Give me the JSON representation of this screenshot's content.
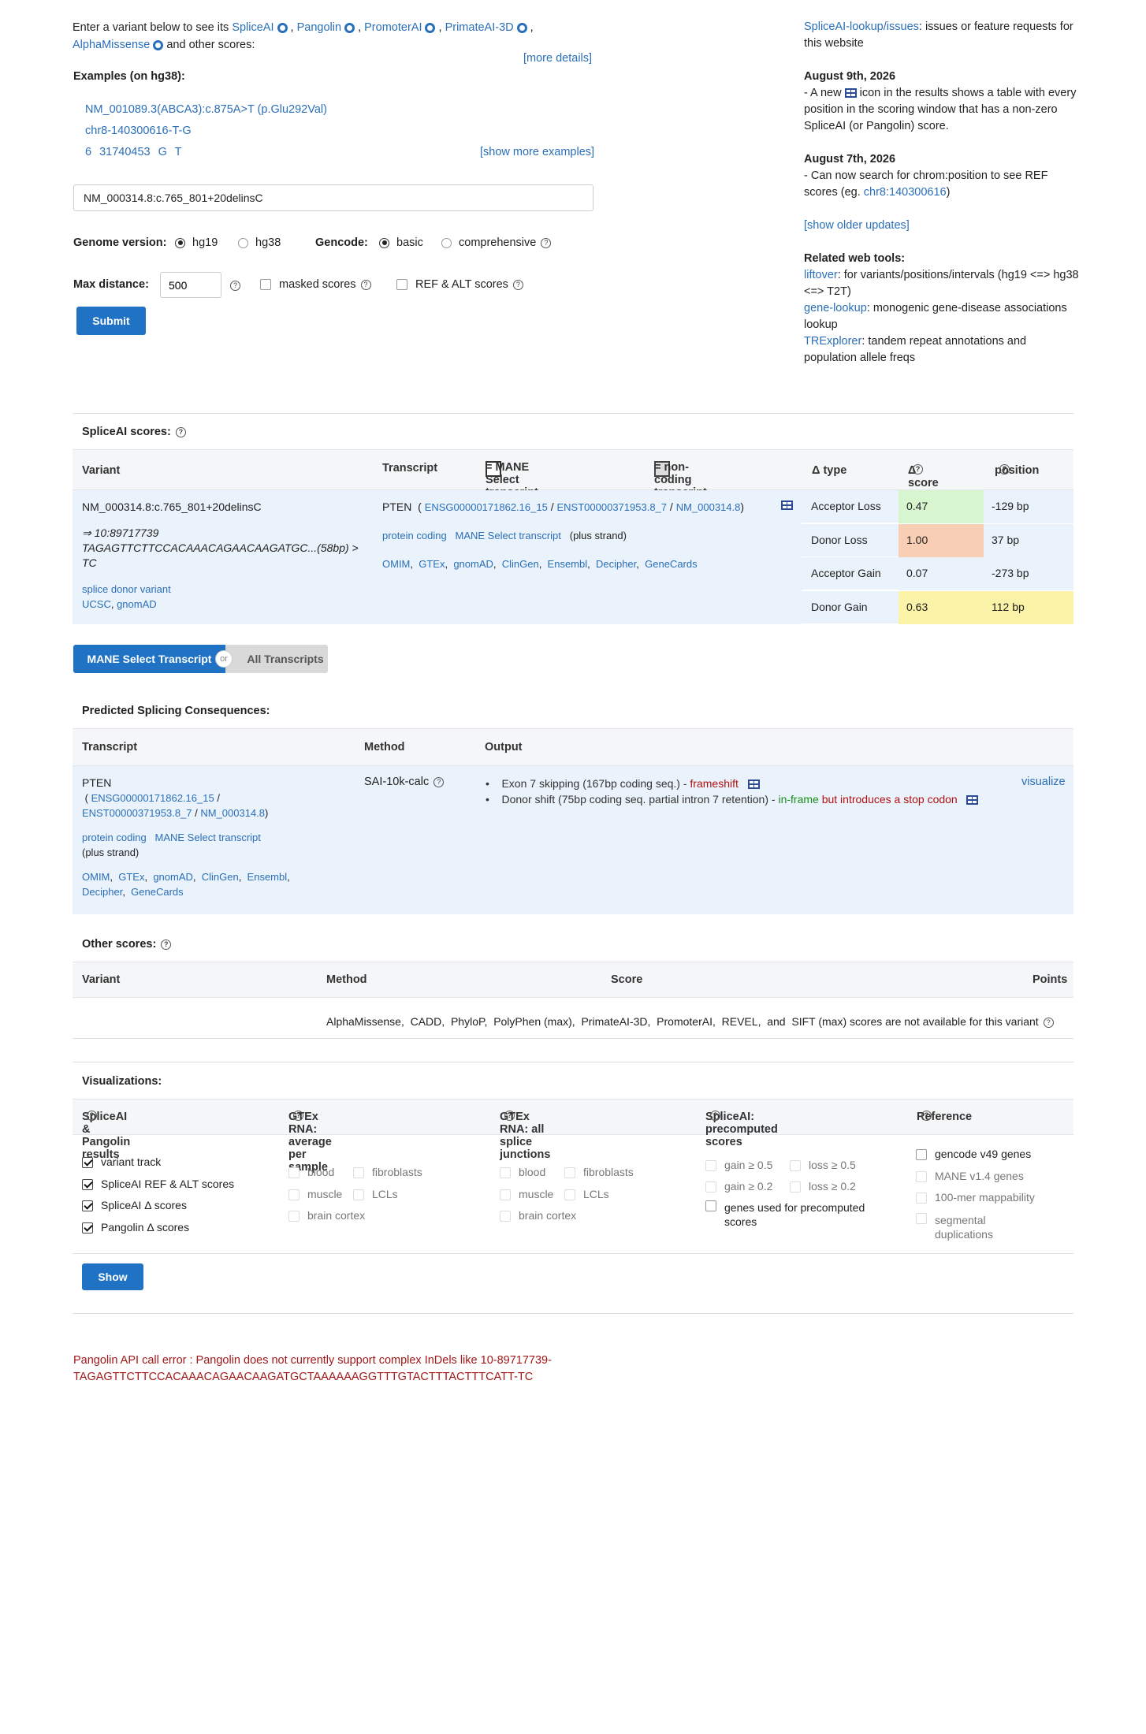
{
  "intro": {
    "prefix": "Enter a variant below to see its",
    "tools": [
      "SpliceAI",
      "Pangolin",
      "PromoterAI",
      "PrimateAI-3D",
      "AlphaMissense"
    ],
    "comma": ",",
    "suffix": "and other scores:",
    "more_details": "[more details]"
  },
  "examples": {
    "title": "Examples (on hg38):",
    "items": [
      "NM_001089.3(ABCA3):c.875A>T (p.Glu292Val)",
      "chr8-140300616-T-G",
      "6 31740453 G T"
    ],
    "show_more": "[show more examples]"
  },
  "search": {
    "value": "NM_000314.8:c.765_801+20delinsC"
  },
  "options": {
    "genome_label": "Genome version:",
    "genome": [
      "hg19",
      "hg38"
    ],
    "gencode_label": "Gencode:",
    "gencode": [
      "basic",
      "comprehensive"
    ],
    "maxdist_label": "Max distance:",
    "maxdist_value": "500",
    "masked": "masked scores",
    "refalt": "REF & ALT scores",
    "submit": "Submit"
  },
  "sidebar": {
    "issues_link": "SpliceAI-lookup/issues",
    "issues_text": ": issues or feature requests for this website",
    "u1_date": "August 9th, 2026",
    "u1_a": "- A new",
    "u1_b": "icon in the results shows a table with every position in the scoring window that has a non-zero SpliceAI (or Pangolin) score.",
    "u2_date": "August 7th, 2026",
    "u2_a": "- Can now search for chrom:position to see REF scores (eg.",
    "u2_link": "chr8:140300616",
    "u2_b": ")",
    "older": "[show older updates]",
    "related_title": "Related web tools:",
    "tools": [
      {
        "name": "liftover",
        "desc": ": for variants/positions/intervals (hg19 <=> hg38 <=> T2T)"
      },
      {
        "name": "gene-lookup",
        "desc": ": monogenic gene-disease associations lookup"
      },
      {
        "name": "TRExplorer",
        "desc": ": tandem repeat annotations and population allele freqs"
      }
    ]
  },
  "spliceai": {
    "title": "SpliceAI scores:",
    "headers": {
      "variant": "Variant",
      "transcript": "Transcript",
      "mane_legend": "= MANE Select transcript",
      "noncoding_legend": "= non-coding transcript",
      "dtype": "Δ type",
      "dscore": "Δ score",
      "position": "position"
    },
    "variant": "NM_000314.8:c.765_801+20delinsC",
    "arrow_line": "⇒ 10:89717739",
    "seq_line": "TAGAGTTCTTCCACAAACAGAACAAGATGC...(58bp) > TC",
    "consequence": "splice donor variant",
    "var_links": [
      "UCSC",
      "gnomAD"
    ],
    "gene": "PTEN",
    "tx_ids": [
      "ENSG00000171862.16_15",
      "ENST00000371953.8_7",
      "NM_000314.8"
    ],
    "tx_tags": [
      "protein coding",
      "MANE Select transcript"
    ],
    "strand": "(plus strand)",
    "tx_links": [
      "OMIM",
      "GTEx",
      "gnomAD",
      "ClinGen",
      "Ensembl",
      "Decipher",
      "GeneCards"
    ],
    "rows": [
      {
        "type": "Acceptor Loss",
        "score": "0.47",
        "pos": "-129 bp"
      },
      {
        "type": "Donor Loss",
        "score": "1.00",
        "pos": "37 bp"
      },
      {
        "type": "Acceptor Gain",
        "score": "0.07",
        "pos": "-273 bp"
      },
      {
        "type": "Donor Gain",
        "score": "0.63",
        "pos": "112 bp"
      }
    ],
    "score_colors": [
      "#d7f6d0",
      "#f8cfb5",
      "#eaf2fb",
      "#fbf3a8"
    ],
    "pos_colors": [
      "#eaf2fb",
      "#eaf2fb",
      "#eaf2fb",
      "#fbf3a8"
    ]
  },
  "toggle": {
    "mane": "MANE Select Transcript",
    "or": "or",
    "all": "All Transcripts"
  },
  "predicted": {
    "title": "Predicted Splicing Consequences:",
    "headers": {
      "transcript": "Transcript",
      "method": "Method",
      "output": "Output"
    },
    "gene": "PTEN",
    "tx_ids": [
      "ENSG00000171862.16_15",
      "ENST00000371953.8_7",
      "NM_000314.8"
    ],
    "tags": [
      "protein coding",
      "MANE Select transcript"
    ],
    "strand": "(plus strand)",
    "links": [
      "OMIM",
      "GTEx",
      "gnomAD",
      "ClinGen",
      "Ensembl",
      "Decipher",
      "GeneCards"
    ],
    "method": "SAI-10k-calc",
    "out1_text": "Exon 7 skipping (167bp coding seq.) -",
    "out1_flag": "frameshift",
    "out2_text": "Donor shift (75bp coding seq. partial intron 7 retention) -",
    "out2_flag1": "in-frame",
    "out2_flag2": "but introduces a stop codon",
    "visualize": "visualize"
  },
  "other": {
    "title": "Other scores:",
    "headers": {
      "variant": "Variant",
      "method": "Method",
      "score": "Score",
      "points": "Points"
    },
    "methods": [
      "AlphaMissense",
      "CADD",
      "PhyloP",
      "PolyPhen (max)",
      "PrimateAI-3D",
      "PromoterAI",
      "REVEL"
    ],
    "and_text": "and",
    "last_method": "SIFT (max)",
    "not_available": "scores are not available for this variant"
  },
  "viz": {
    "title": "Visualizations:",
    "col_titles": [
      "SpliceAI & Pangolin results",
      "GTEx RNA: average per sample",
      "GTEx RNA: all splice junctions",
      "SpliceAI: precomputed scores",
      "Reference"
    ],
    "col1": [
      "variant track",
      "SpliceAI REF & ALT scores",
      "SpliceAI Δ scores",
      "Pangolin Δ scores"
    ],
    "gtex_avg": [
      "blood",
      "fibroblasts",
      "muscle",
      "LCLs",
      "brain cortex"
    ],
    "gtex_junc": [
      "blood",
      "fibroblasts",
      "muscle",
      "LCLs",
      "brain cortex"
    ],
    "precomp": [
      "gain ≥ 0.5",
      "loss ≥ 0.5",
      "gain ≥ 0.2",
      "loss ≥ 0.2",
      "genes used for precomputed scores"
    ],
    "reference": [
      "gencode v49 genes",
      "MANE v1.4 genes",
      "100-mer mappability",
      "segmental duplications"
    ],
    "show": "Show"
  },
  "error": {
    "line1": "Pangolin API call error : Pangolin does not currently support complex InDels like 10-89717739-",
    "line2": "TAGAGTTCTTCCACAAACAGAACAAGATGCTAAAAAAGGTTTGTACTTTACTTTCATT-TC",
    "color": "#a01818"
  }
}
